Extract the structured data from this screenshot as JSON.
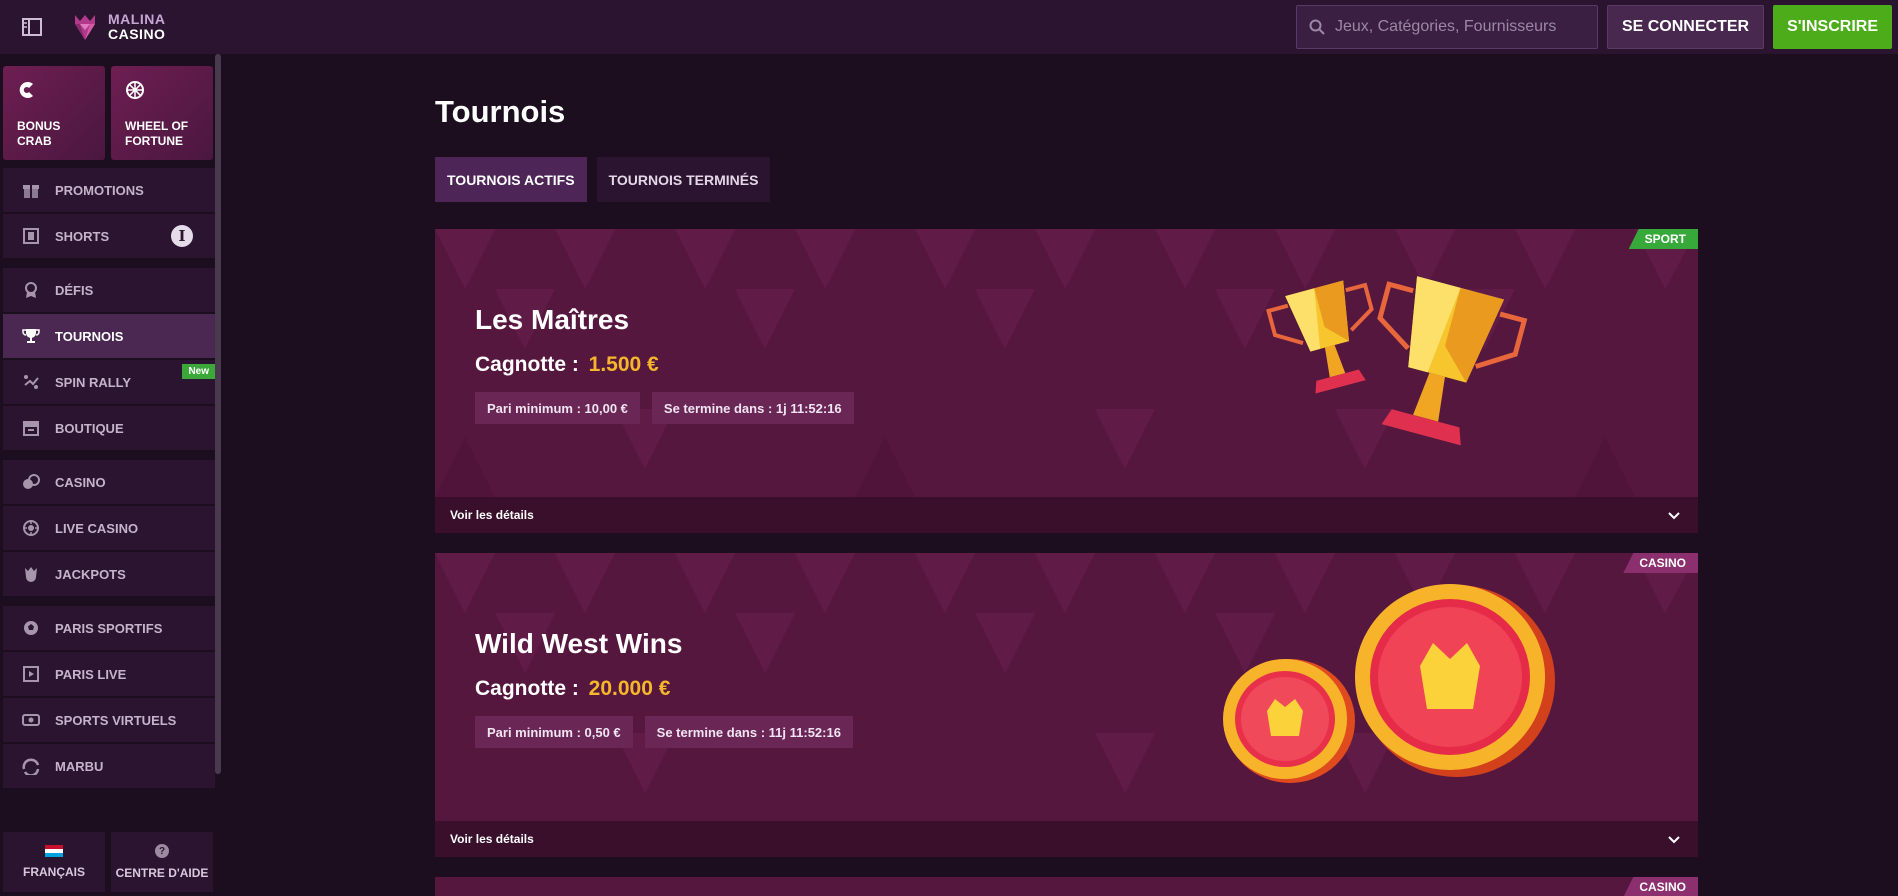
{
  "header": {
    "logo_line1": "MALINA",
    "logo_line2": "CASINO",
    "search_placeholder": "Jeux, Catégories, Fournisseurs",
    "login_label": "SE CONNECTER",
    "signup_label": "S'INSCRIRE"
  },
  "sidebar": {
    "tiles": [
      {
        "label": "BONUS\nCRAB",
        "line1": "BONUS",
        "line2": "CRAB",
        "icon": "crab-claw-icon"
      },
      {
        "label": "WHEEL OF\nFORTUNE",
        "line1": "WHEEL OF",
        "line2": "FORTUNE",
        "icon": "wheel-icon"
      }
    ],
    "groups": [
      [
        {
          "label": "PROMOTIONS",
          "icon": "gift-icon"
        },
        {
          "label": "SHORTS",
          "icon": "film-icon",
          "info": "i"
        }
      ],
      [
        {
          "label": "DÉFIS",
          "icon": "medal-icon"
        },
        {
          "label": "TOURNOIS",
          "icon": "trophy-icon",
          "active": true
        },
        {
          "label": "SPIN RALLY",
          "icon": "rally-icon",
          "badge": "New"
        },
        {
          "label": "BOUTIQUE",
          "icon": "shop-icon"
        }
      ],
      [
        {
          "label": "CASINO",
          "icon": "casino-icon"
        },
        {
          "label": "LIVE CASINO",
          "icon": "live-casino-icon"
        },
        {
          "label": "JACKPOTS",
          "icon": "jackpot-icon"
        }
      ],
      [
        {
          "label": "PARIS SPORTIFS",
          "icon": "football-icon"
        },
        {
          "label": "PARIS LIVE",
          "icon": "live-bet-icon"
        },
        {
          "label": "SPORTS VIRTUELS",
          "icon": "virtual-sports-icon"
        },
        {
          "label": "MARBU",
          "icon": "marbu-icon"
        }
      ]
    ],
    "bottom": {
      "language_label": "FRANÇAIS",
      "help_label": "CENTRE D'AIDE",
      "help_icon_glyph": "?"
    }
  },
  "main": {
    "title": "Tournois",
    "tabs": [
      {
        "label": "TOURNOIS ACTIFS",
        "active": true
      },
      {
        "label": "TOURNOIS TERMINÉS",
        "active": false
      }
    ],
    "tournaments": [
      {
        "tag": "SPORT",
        "title": "Les Maîtres",
        "jackpot_label": "Cagnotte :",
        "jackpot_value": "1.500 €",
        "min_bet": "Pari minimum : 10,00 €",
        "ends_in": "Se termine dans : 1j 11:52:16",
        "details_label": "Voir les détails",
        "art": "trophies"
      },
      {
        "tag": "CASINO",
        "title": "Wild West Wins",
        "jackpot_label": "Cagnotte :",
        "jackpot_value": "20.000 €",
        "min_bet": "Pari minimum : 0,50 €",
        "ends_in": "Se termine dans : 11j 11:52:16",
        "details_label": "Voir les détails",
        "art": "coins"
      },
      {
        "tag": "CASINO"
      }
    ]
  },
  "colors": {
    "accent_green": "#4dac1a",
    "jackpot_gold": "#f5b62b",
    "card_bg": "#56173f",
    "tag_sport": "#37a83a",
    "tag_casino": "#8b2f6e"
  }
}
